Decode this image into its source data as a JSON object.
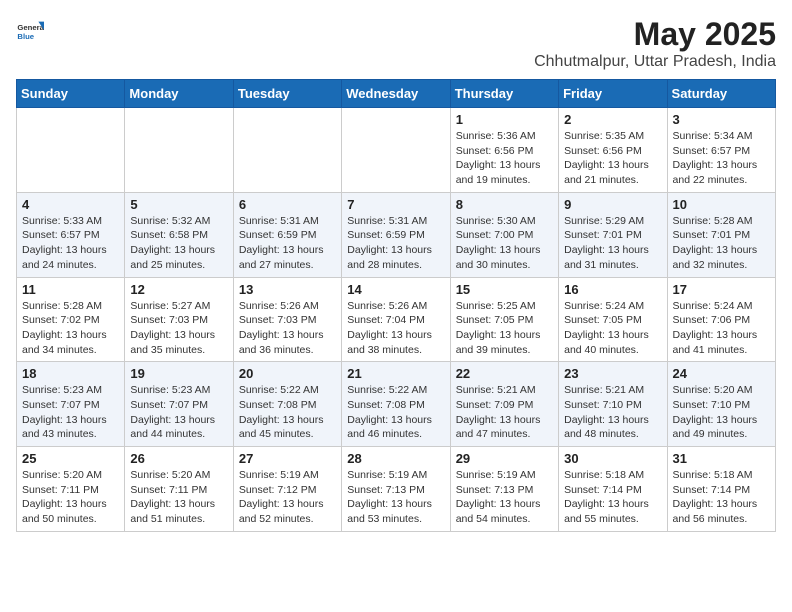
{
  "header": {
    "logo": {
      "general": "General",
      "blue": "Blue"
    },
    "title": "May 2025",
    "subtitle": "Chhutmalpur, Uttar Pradesh, India"
  },
  "weekdays": [
    "Sunday",
    "Monday",
    "Tuesday",
    "Wednesday",
    "Thursday",
    "Friday",
    "Saturday"
  ],
  "weeks": [
    [
      null,
      null,
      null,
      null,
      {
        "day": 1,
        "sunrise": "5:36 AM",
        "sunset": "6:56 PM",
        "daylight": "13 hours and 19 minutes."
      },
      {
        "day": 2,
        "sunrise": "5:35 AM",
        "sunset": "6:56 PM",
        "daylight": "13 hours and 21 minutes."
      },
      {
        "day": 3,
        "sunrise": "5:34 AM",
        "sunset": "6:57 PM",
        "daylight": "13 hours and 22 minutes."
      }
    ],
    [
      {
        "day": 4,
        "sunrise": "5:33 AM",
        "sunset": "6:57 PM",
        "daylight": "13 hours and 24 minutes."
      },
      {
        "day": 5,
        "sunrise": "5:32 AM",
        "sunset": "6:58 PM",
        "daylight": "13 hours and 25 minutes."
      },
      {
        "day": 6,
        "sunrise": "5:31 AM",
        "sunset": "6:59 PM",
        "daylight": "13 hours and 27 minutes."
      },
      {
        "day": 7,
        "sunrise": "5:31 AM",
        "sunset": "6:59 PM",
        "daylight": "13 hours and 28 minutes."
      },
      {
        "day": 8,
        "sunrise": "5:30 AM",
        "sunset": "7:00 PM",
        "daylight": "13 hours and 30 minutes."
      },
      {
        "day": 9,
        "sunrise": "5:29 AM",
        "sunset": "7:01 PM",
        "daylight": "13 hours and 31 minutes."
      },
      {
        "day": 10,
        "sunrise": "5:28 AM",
        "sunset": "7:01 PM",
        "daylight": "13 hours and 32 minutes."
      }
    ],
    [
      {
        "day": 11,
        "sunrise": "5:28 AM",
        "sunset": "7:02 PM",
        "daylight": "13 hours and 34 minutes."
      },
      {
        "day": 12,
        "sunrise": "5:27 AM",
        "sunset": "7:03 PM",
        "daylight": "13 hours and 35 minutes."
      },
      {
        "day": 13,
        "sunrise": "5:26 AM",
        "sunset": "7:03 PM",
        "daylight": "13 hours and 36 minutes."
      },
      {
        "day": 14,
        "sunrise": "5:26 AM",
        "sunset": "7:04 PM",
        "daylight": "13 hours and 38 minutes."
      },
      {
        "day": 15,
        "sunrise": "5:25 AM",
        "sunset": "7:05 PM",
        "daylight": "13 hours and 39 minutes."
      },
      {
        "day": 16,
        "sunrise": "5:24 AM",
        "sunset": "7:05 PM",
        "daylight": "13 hours and 40 minutes."
      },
      {
        "day": 17,
        "sunrise": "5:24 AM",
        "sunset": "7:06 PM",
        "daylight": "13 hours and 41 minutes."
      }
    ],
    [
      {
        "day": 18,
        "sunrise": "5:23 AM",
        "sunset": "7:07 PM",
        "daylight": "13 hours and 43 minutes."
      },
      {
        "day": 19,
        "sunrise": "5:23 AM",
        "sunset": "7:07 PM",
        "daylight": "13 hours and 44 minutes."
      },
      {
        "day": 20,
        "sunrise": "5:22 AM",
        "sunset": "7:08 PM",
        "daylight": "13 hours and 45 minutes."
      },
      {
        "day": 21,
        "sunrise": "5:22 AM",
        "sunset": "7:08 PM",
        "daylight": "13 hours and 46 minutes."
      },
      {
        "day": 22,
        "sunrise": "5:21 AM",
        "sunset": "7:09 PM",
        "daylight": "13 hours and 47 minutes."
      },
      {
        "day": 23,
        "sunrise": "5:21 AM",
        "sunset": "7:10 PM",
        "daylight": "13 hours and 48 minutes."
      },
      {
        "day": 24,
        "sunrise": "5:20 AM",
        "sunset": "7:10 PM",
        "daylight": "13 hours and 49 minutes."
      }
    ],
    [
      {
        "day": 25,
        "sunrise": "5:20 AM",
        "sunset": "7:11 PM",
        "daylight": "13 hours and 50 minutes."
      },
      {
        "day": 26,
        "sunrise": "5:20 AM",
        "sunset": "7:11 PM",
        "daylight": "13 hours and 51 minutes."
      },
      {
        "day": 27,
        "sunrise": "5:19 AM",
        "sunset": "7:12 PM",
        "daylight": "13 hours and 52 minutes."
      },
      {
        "day": 28,
        "sunrise": "5:19 AM",
        "sunset": "7:13 PM",
        "daylight": "13 hours and 53 minutes."
      },
      {
        "day": 29,
        "sunrise": "5:19 AM",
        "sunset": "7:13 PM",
        "daylight": "13 hours and 54 minutes."
      },
      {
        "day": 30,
        "sunrise": "5:18 AM",
        "sunset": "7:14 PM",
        "daylight": "13 hours and 55 minutes."
      },
      {
        "day": 31,
        "sunrise": "5:18 AM",
        "sunset": "7:14 PM",
        "daylight": "13 hours and 56 minutes."
      }
    ]
  ]
}
